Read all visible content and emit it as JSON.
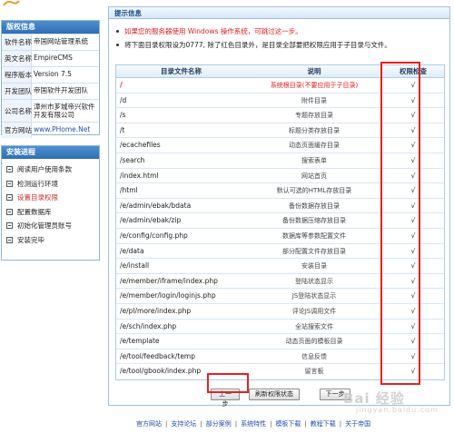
{
  "sidebar": {
    "info_title": "版权信息",
    "info_rows": [
      {
        "key": "软件名称",
        "value": "帝国网站管理系统"
      },
      {
        "key": "英文名称",
        "value": "EmpireCMS"
      },
      {
        "key": "程序版本",
        "value": "Version 7.5"
      },
      {
        "key": "开发团队",
        "value": "帝国软件开发团队"
      },
      {
        "key": "公司名称",
        "value": "漳州市芗城帝兴软件开发有限公司"
      },
      {
        "key": "官方网站",
        "value": "www.PHome.Net"
      }
    ],
    "steps_title": "安装进程",
    "steps": [
      {
        "label": "阅读用户使用条款",
        "active": false
      },
      {
        "label": "检测运行环境",
        "active": false
      },
      {
        "label": "设置目录权限",
        "active": true
      },
      {
        "label": "配置数据库",
        "active": false
      },
      {
        "label": "初始化管理员账号",
        "active": false
      },
      {
        "label": "安装完毕",
        "active": false
      }
    ]
  },
  "main": {
    "title": "提示信息",
    "tips": [
      "如果您的服务器使用 Windows 操作系统，可跳过这一步。",
      "将下面目录权限设为0777, 除了红色目录外，是目录全部要把权限应用于子目录与文件。"
    ],
    "table": {
      "headers": [
        "目录文件名称",
        "说明",
        "权限检查"
      ],
      "rows": [
        {
          "name": "/",
          "desc": "系统根目录(不要应用于子目录)",
          "check": "√",
          "highlight": true
        },
        {
          "name": "/d",
          "desc": "附件目录",
          "check": "√"
        },
        {
          "name": "/s",
          "desc": "专题存放目录",
          "check": "√"
        },
        {
          "name": "/t",
          "desc": "标题分类存放目录",
          "check": "√"
        },
        {
          "name": "/ecachefiles",
          "desc": "动态页面缓存目录",
          "check": "√"
        },
        {
          "name": "/search",
          "desc": "搜索表单",
          "check": "√"
        },
        {
          "name": "/index.html",
          "desc": "网站首页",
          "check": "√"
        },
        {
          "name": "/html",
          "desc": "默认可选的HTML存放目录",
          "check": "√"
        },
        {
          "name": "/e/admin/ebak/bdata",
          "desc": "备份数据存放目录",
          "check": "√"
        },
        {
          "name": "/e/admin/ebak/zip",
          "desc": "备份数据压缩存放目录",
          "check": "√"
        },
        {
          "name": "/e/config/config.php",
          "desc": "数据库等参数配置文件",
          "check": "√"
        },
        {
          "name": "/e/data",
          "desc": "部分配置文件存放目录",
          "check": "√"
        },
        {
          "name": "/e/install",
          "desc": "安装目录",
          "check": "√"
        },
        {
          "name": "/e/member/iframe/index.php",
          "desc": "登陆状态显示",
          "check": "√"
        },
        {
          "name": "/e/member/login/loginjs.php",
          "desc": "JS登陆状态显示",
          "check": "√"
        },
        {
          "name": "/e/pl/more/index.php",
          "desc": "评论JS调用文件",
          "check": "√"
        },
        {
          "name": "/e/sch/index.php",
          "desc": "全站搜索文件",
          "check": "√"
        },
        {
          "name": "/e/template",
          "desc": "动态页面的模板目录",
          "check": "√"
        },
        {
          "name": "/e/tool/feedback/temp",
          "desc": "信息反馈",
          "check": "√"
        },
        {
          "name": "/e/tool/gbook/index.php",
          "desc": "留言板",
          "check": "√"
        }
      ]
    },
    "buttons": {
      "prev": "上一步",
      "refresh": "刷新权限状态",
      "next": "下一步"
    }
  },
  "footer": {
    "links": [
      "官方网站",
      "支持论坛",
      "部分案例",
      "系统特性",
      "模板下载",
      "教程下载",
      "关于帝国"
    ]
  },
  "watermark": {
    "text": "Bai 经验",
    "sub": "jingyan.baidu.com"
  },
  "colors": {
    "accent": "#2f6eb3",
    "highlight": "#e02020",
    "link": "#1c4fae"
  }
}
